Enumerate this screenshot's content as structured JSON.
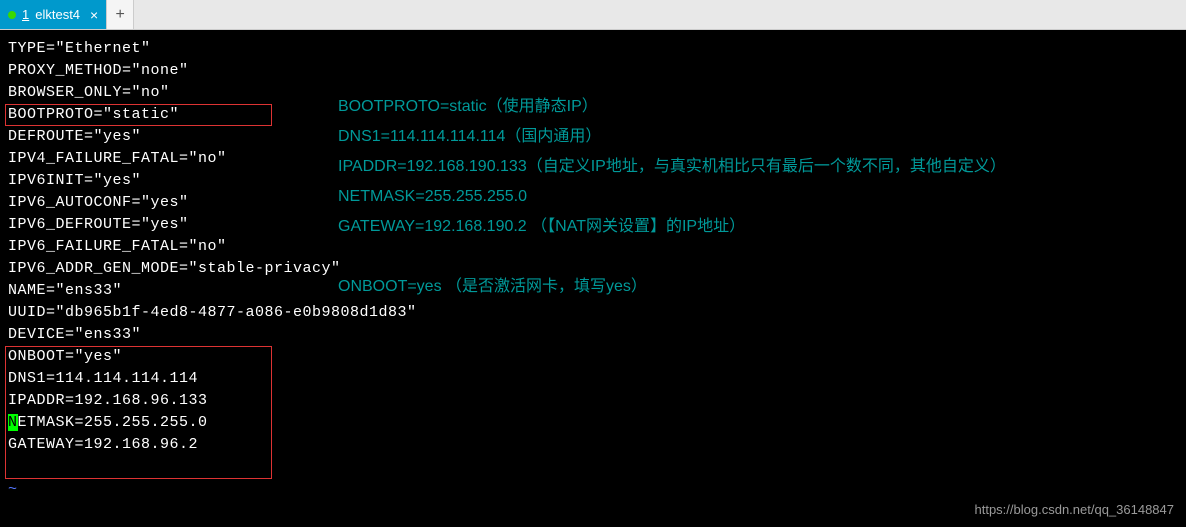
{
  "tab": {
    "number": "1",
    "title": "elktest4",
    "close": "×",
    "add": "+"
  },
  "config": {
    "lines": [
      "TYPE=\"Ethernet\"",
      "PROXY_METHOD=\"none\"",
      "BROWSER_ONLY=\"no\"",
      "BOOTPROTO=\"static\"",
      "DEFROUTE=\"yes\"",
      "IPV4_FAILURE_FATAL=\"no\"",
      "IPV6INIT=\"yes\"",
      "IPV6_AUTOCONF=\"yes\"",
      "IPV6_DEFROUTE=\"yes\"",
      "IPV6_FAILURE_FATAL=\"no\"",
      "IPV6_ADDR_GEN_MODE=\"stable-privacy\"",
      "NAME=\"ens33\"",
      "UUID=\"db965b1f-4ed8-4877-a086-e0b9808d1d83\"",
      "DEVICE=\"ens33\"",
      "ONBOOT=\"yes\"",
      "",
      "DNS1=114.114.114.114",
      "IPADDR=192.168.96.133"
    ],
    "netmask_cursor": "N",
    "netmask_rest": "ETMASK=255.255.255.0",
    "gateway": "GATEWAY=192.168.96.2"
  },
  "annotations": {
    "l1": "BOOTPROTO=static（使用静态IP）",
    "l2": "DNS1=114.114.114.114（国内通用）",
    "l3": "IPADDR=192.168.190.133（自定义IP地址，与真实机相比只有最后一个数不同，其他自定义）",
    "l4": "NETMASK=255.255.255.0",
    "l5": "GATEWAY=192.168.190.2 （【NAT网关设置】的IP地址）",
    "l6": "ONBOOT=yes （是否激活网卡，填写yes）"
  },
  "tilde": "~",
  "watermark": "https://blog.csdn.net/qq_36148847"
}
